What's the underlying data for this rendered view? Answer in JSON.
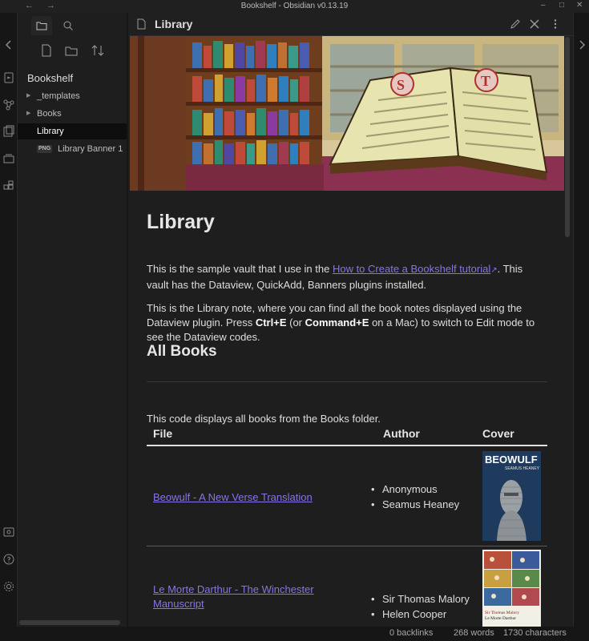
{
  "window": {
    "title": "Bookshelf - Obsidian v0.13.19"
  },
  "sidebar": {
    "vault_name": "Bookshelf",
    "tree": [
      {
        "label": "_templates",
        "type": "folder"
      },
      {
        "label": "Books",
        "type": "folder"
      },
      {
        "label": "Library",
        "type": "file",
        "active": true
      },
      {
        "label": "Library Banner 1",
        "type": "image",
        "badge": "PNG"
      }
    ]
  },
  "view": {
    "title": "Library",
    "heading": "Library",
    "para1": {
      "before": "This is the sample vault that I use in the ",
      "link": "How to Create a Bookshelf tutorial",
      "after": ". This vault has the Dataview, QuickAdd, Banners plugins installed."
    },
    "para2": {
      "t1": "This is the Library note, where you can find all the book notes displayed using the Dataview plugin. Press ",
      "b1": "Ctrl+E",
      "t2": " (or ",
      "b2": "Command+E",
      "t3": " on a Mac) to switch to Edit mode to see the Dataview codes."
    },
    "heading2": "All Books",
    "para3": "This code displays all books from the Books folder.",
    "table": {
      "headers": [
        "File",
        "Author",
        "Cover"
      ],
      "rows": [
        {
          "file": "Beowulf - A New Verse Translation",
          "authors": [
            "Anonymous",
            "Seamus Heaney"
          ],
          "cover_title": "BEOWULF",
          "cover_sub": "SEAMUS HEANEY"
        },
        {
          "file": "Le Morte Darthur - The Winchester Manuscript",
          "authors": [
            "Sir Thomas Malory",
            "Helen Cooper"
          ],
          "cover_title": "Sir Thomas Malory",
          "cover_sub": "Le Morte Darthur"
        }
      ]
    }
  },
  "statusbar": {
    "backlinks": "0 backlinks",
    "words": "268 words",
    "characters": "1730 characters"
  },
  "colors": {
    "accent": "#8a73e6",
    "background": "#1e1e1e",
    "text": "#dcddde"
  }
}
